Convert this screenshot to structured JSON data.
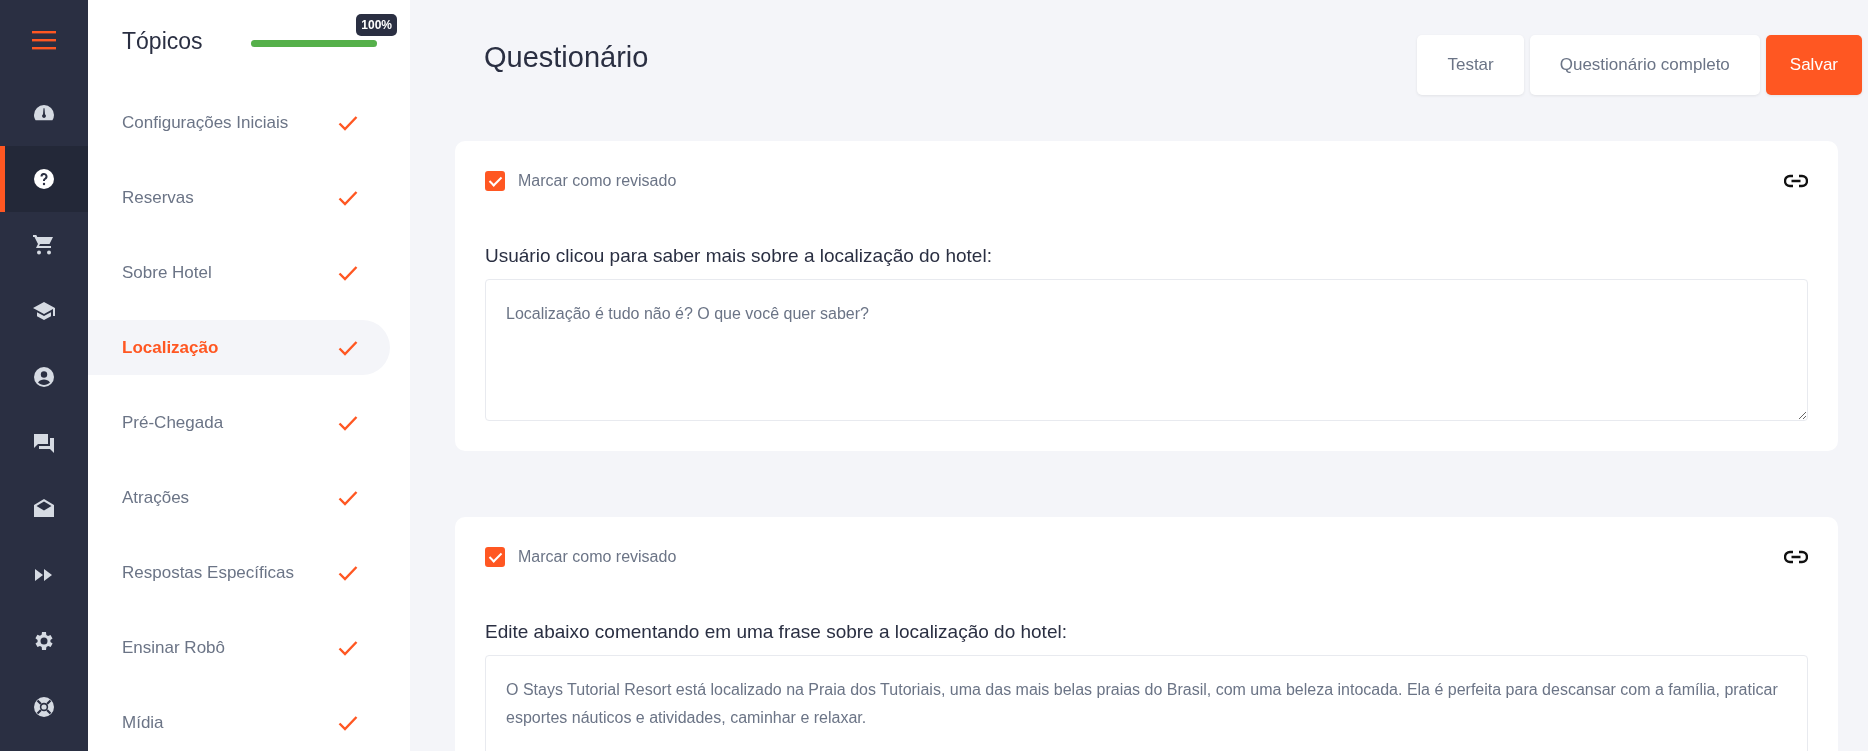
{
  "nav": [
    {
      "selected": false
    },
    {
      "selected": true
    },
    {
      "selected": false
    },
    {
      "selected": false
    },
    {
      "selected": false
    },
    {
      "selected": false
    },
    {
      "selected": false
    },
    {
      "selected": false
    },
    {
      "selected": false
    },
    {
      "selected": false
    }
  ],
  "topics": {
    "title": "Tópicos",
    "progress": {
      "level": 1,
      "label": "100%"
    },
    "items": [
      {
        "label": "Configurações Iniciais",
        "selected": false,
        "done": true
      },
      {
        "label": "Reservas",
        "selected": false,
        "done": true
      },
      {
        "label": "Sobre Hotel",
        "selected": false,
        "done": true
      },
      {
        "label": "Localização",
        "selected": true,
        "done": true
      },
      {
        "label": "Pré-Chegada",
        "selected": false,
        "done": true
      },
      {
        "label": "Atrações",
        "selected": false,
        "done": true
      },
      {
        "label": "Respostas Específicas",
        "selected": false,
        "done": true
      },
      {
        "label": "Ensinar Robô",
        "selected": false,
        "done": true
      },
      {
        "label": "Mídia",
        "selected": false,
        "done": true
      }
    ]
  },
  "page": {
    "title": "Questionário",
    "buttons": [
      {
        "label": "Testar",
        "kind": "plain"
      },
      {
        "label": "Questionário completo",
        "kind": "plain"
      },
      {
        "label": "Salvar",
        "kind": "primary"
      }
    ]
  },
  "cards": [
    {
      "review_label": "Marcar como revisado",
      "checked": true,
      "question": "Usuário clicou para saber mais sobre a localização do hotel:",
      "answer": "Localização é tudo não é? O que você quer saber?"
    },
    {
      "review_label": "Marcar como revisado",
      "checked": true,
      "question": "Edite abaixo comentando em uma frase sobre a localização do hotel:",
      "answer": "O Stays Tutorial Resort está localizado na Praia dos Tutoriais, uma das mais belas praias do Brasil, com uma beleza intocada. Ela é perfeita para descansar com a família, praticar esportes náuticos e atividades, caminhar e relaxar."
    }
  ]
}
